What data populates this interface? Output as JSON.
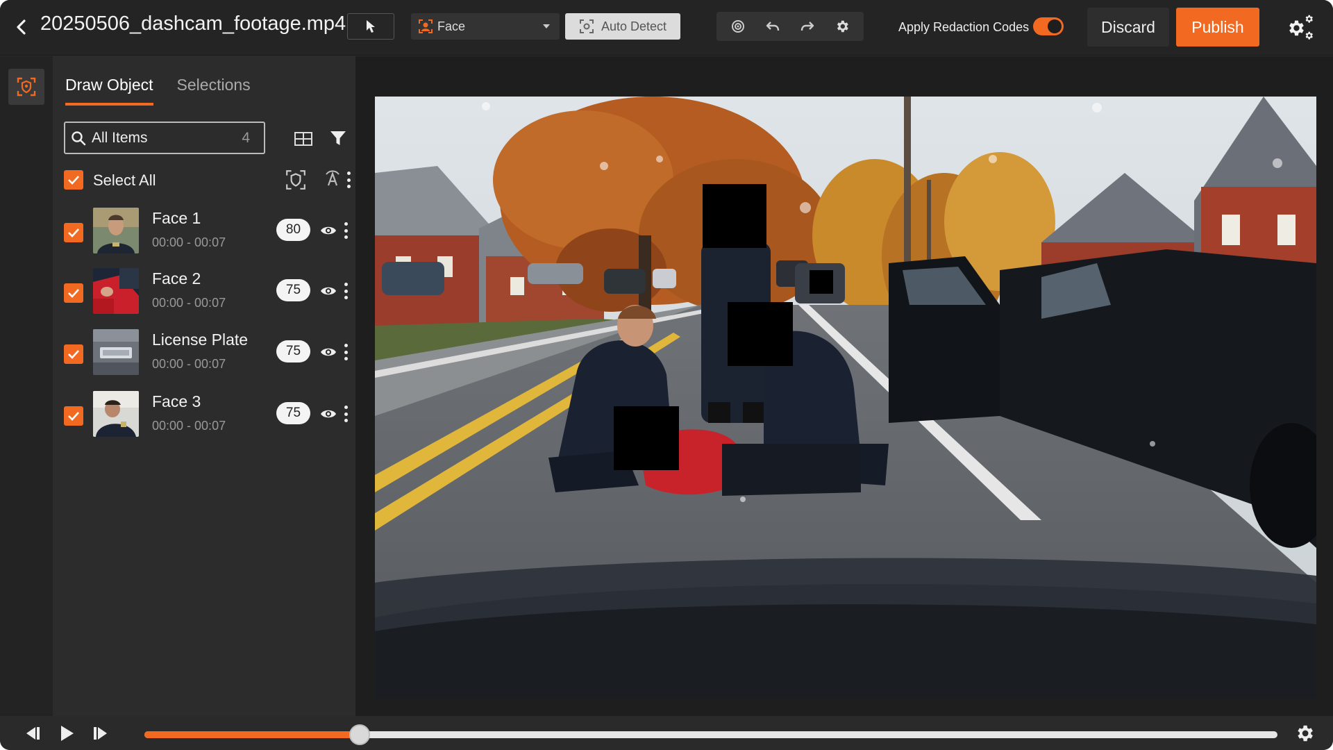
{
  "header": {
    "file_name": "20250506_dashcam_footage.mp4",
    "object_type": "Face",
    "auto_detect_label": "Auto Detect",
    "apply_redaction_label": "Apply Redaction Codes",
    "apply_redaction_on": true,
    "discard_label": "Discard",
    "publish_label": "Publish"
  },
  "panel": {
    "tabs": [
      {
        "label": "Draw Object",
        "active": true
      },
      {
        "label": "Selections",
        "active": false
      }
    ],
    "search": {
      "placeholder": "All Items",
      "count": "4"
    },
    "select_all_label": "Select All",
    "items": [
      {
        "name": "Face 1",
        "time": "00:00 - 00:07",
        "score": "80",
        "checked": true
      },
      {
        "name": "Face 2",
        "time": "00:00 - 00:07",
        "score": "75",
        "checked": true
      },
      {
        "name": "License Plate",
        "time": "00:00 - 00:07",
        "score": "75",
        "checked": true
      },
      {
        "name": "Face 3",
        "time": "00:00 - 00:07",
        "score": "75",
        "checked": true
      }
    ]
  },
  "player": {
    "progress": 0.19
  },
  "colors": {
    "accent": "#f26a21",
    "background": "#2b2b2b",
    "viewer_bg": "#1e1e1e"
  },
  "icons": [
    "back-arrow-icon",
    "cursor-icon",
    "face-detect-icon",
    "scan-icon",
    "target-icon",
    "undo-icon",
    "redo-icon",
    "gear-icon",
    "gears-icon",
    "search-icon",
    "grid-icon",
    "filter-icon",
    "check-icon",
    "auto-tag-icon",
    "eye-icon",
    "kebab-icon",
    "step-back-icon",
    "play-icon",
    "step-forward-icon"
  ]
}
